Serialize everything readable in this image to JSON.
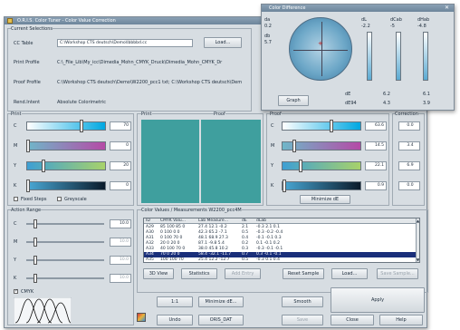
{
  "main": {
    "title": "O.R.I.S. Color Tuner - Color Value Correction",
    "current_selections": {
      "header": "Current Selections",
      "cc_table_label": "CC Table",
      "cc_table_value": "C:\\Workshop CTS deutsch\\Demo\\lbbbbd.cc",
      "load_label": "Load...",
      "print_profile_label": "Print Profile",
      "print_profile_value": "C:\\_File_Lib\\My_icc\\Dimedia_Mohn_CMYK_Druck\\Dimedia_Mohn_CMYK_Dr",
      "proof_profile_label": "Proof Profile",
      "proof_profile_value": "C:\\Workshop CTS deutsch\\Demo\\W2200_pcc1 txt; C:\\Workshop CTS deutsch\\Dem",
      "rendintent_label": "Rend.Intent",
      "rendintent_value": "Absolute Colorimetric"
    },
    "print": {
      "header": "Print",
      "channels": [
        {
          "label": "C",
          "value": "70",
          "pos": 0.7
        },
        {
          "label": "M",
          "value": "0",
          "pos": 0.0
        },
        {
          "label": "Y",
          "value": "20",
          "pos": 0.2
        },
        {
          "label": "K",
          "value": "0",
          "pos": 0.0
        }
      ],
      "fixed_steps": "Fixed Steps",
      "greyscale": "Greyscale"
    },
    "preview": {
      "print_label": "Print",
      "proof_label": "Proof",
      "color": "#3f9f9e"
    },
    "proof": {
      "header": "Proof",
      "channels": [
        {
          "label": "C",
          "value": "63.6",
          "pos": 0.636
        },
        {
          "label": "M",
          "value": "14.5",
          "pos": 0.145
        },
        {
          "label": "Y",
          "value": "22.1",
          "pos": 0.221
        },
        {
          "label": "K",
          "value": "0.9",
          "pos": 0.009
        }
      ],
      "minimize_label": "Minimize dE"
    },
    "correction": {
      "header": "Correction",
      "values": [
        "0.0",
        "3.4",
        "6.9",
        "0.0"
      ]
    },
    "action_range": {
      "header": "Action Range",
      "channels": [
        {
          "label": "C",
          "value": "10.0",
          "pos": 0.1
        },
        {
          "label": "M",
          "value": "10.0",
          "pos": 0.1
        },
        {
          "label": "Y",
          "value": "10.0",
          "pos": 0.1
        },
        {
          "label": "K",
          "value": "10.0",
          "pos": 0.1
        }
      ],
      "cmyk_label": "CMYK"
    },
    "table": {
      "header": "Color Values / Measurements W2200_pcc4M",
      "columns": [
        "ID",
        "CMYK Valu...",
        "Lab Measure...",
        "dE",
        "dLab"
      ],
      "rows": [
        [
          "A29",
          "85 100 85 0",
          "27.4 12.1 -0.2",
          "2.1",
          "-0.3 2.1 0.1"
        ],
        [
          "A30",
          "0 100 0 0",
          "42.3 65.2 -7.1",
          "0.5",
          "-0.3 -0.2 -0.4"
        ],
        [
          "A31",
          "0 100 70 0",
          "48.1 68.9 27.3",
          "0.4",
          "-0.1 -0.1 0.3"
        ],
        [
          "A32",
          "20 0 20 0",
          "87.1 -9.8 5.4",
          "0.2",
          "0.1 -0.1 0.2"
        ],
        [
          "A33",
          "40 100 70 0",
          "38.0 45.8 10.2",
          "0.3",
          "-0.3 -0.1 -0.1"
        ],
        [
          "A34",
          "70 0 20 0",
          "58.4 -32.1 -11.7",
          "0.7",
          "0.3 -0.1 -0.1"
        ],
        [
          "A35",
          "100 100 70",
          "25.4 12.2 -12.7",
          "0.5",
          "-0.3 0.1 0.4"
        ]
      ],
      "selected_index": 5
    },
    "buttons": {
      "view3d": "3D View",
      "statistics": "Statistics",
      "add_entry": "Add Entry",
      "reset_sample": "Reset Sample",
      "load": "Load...",
      "save_sample": "Save Sample...",
      "one_to_one": "1:1",
      "minimize_de": "Minimize dE...",
      "smooth": "Smooth",
      "apply": "Apply",
      "undo": "Undo",
      "oris_dat": "ORIS_DAT",
      "save": "Save",
      "close": "Close",
      "help": "Help"
    }
  },
  "difference": {
    "title": "Color Difference",
    "da_label": "da",
    "da_value": "0.2",
    "db_label": "db",
    "db_value": "5.7",
    "dl_label": "dL",
    "dl_value": "-2.2",
    "dcab_label": "dCab",
    "dcab_value": "-5",
    "dhab_label": "dHab",
    "dhab_value": "-4.8",
    "graph_label": "Graph",
    "de_label": "dE",
    "de_value": "6.2",
    "de94_label": "dE94",
    "de94_value": "4.3",
    "extra": [
      "6.1",
      "3.9"
    ]
  },
  "colors": {
    "accent": "#3f9f9e",
    "selected_row": "#1a2f7a",
    "window_bg": "#d7dde2"
  }
}
